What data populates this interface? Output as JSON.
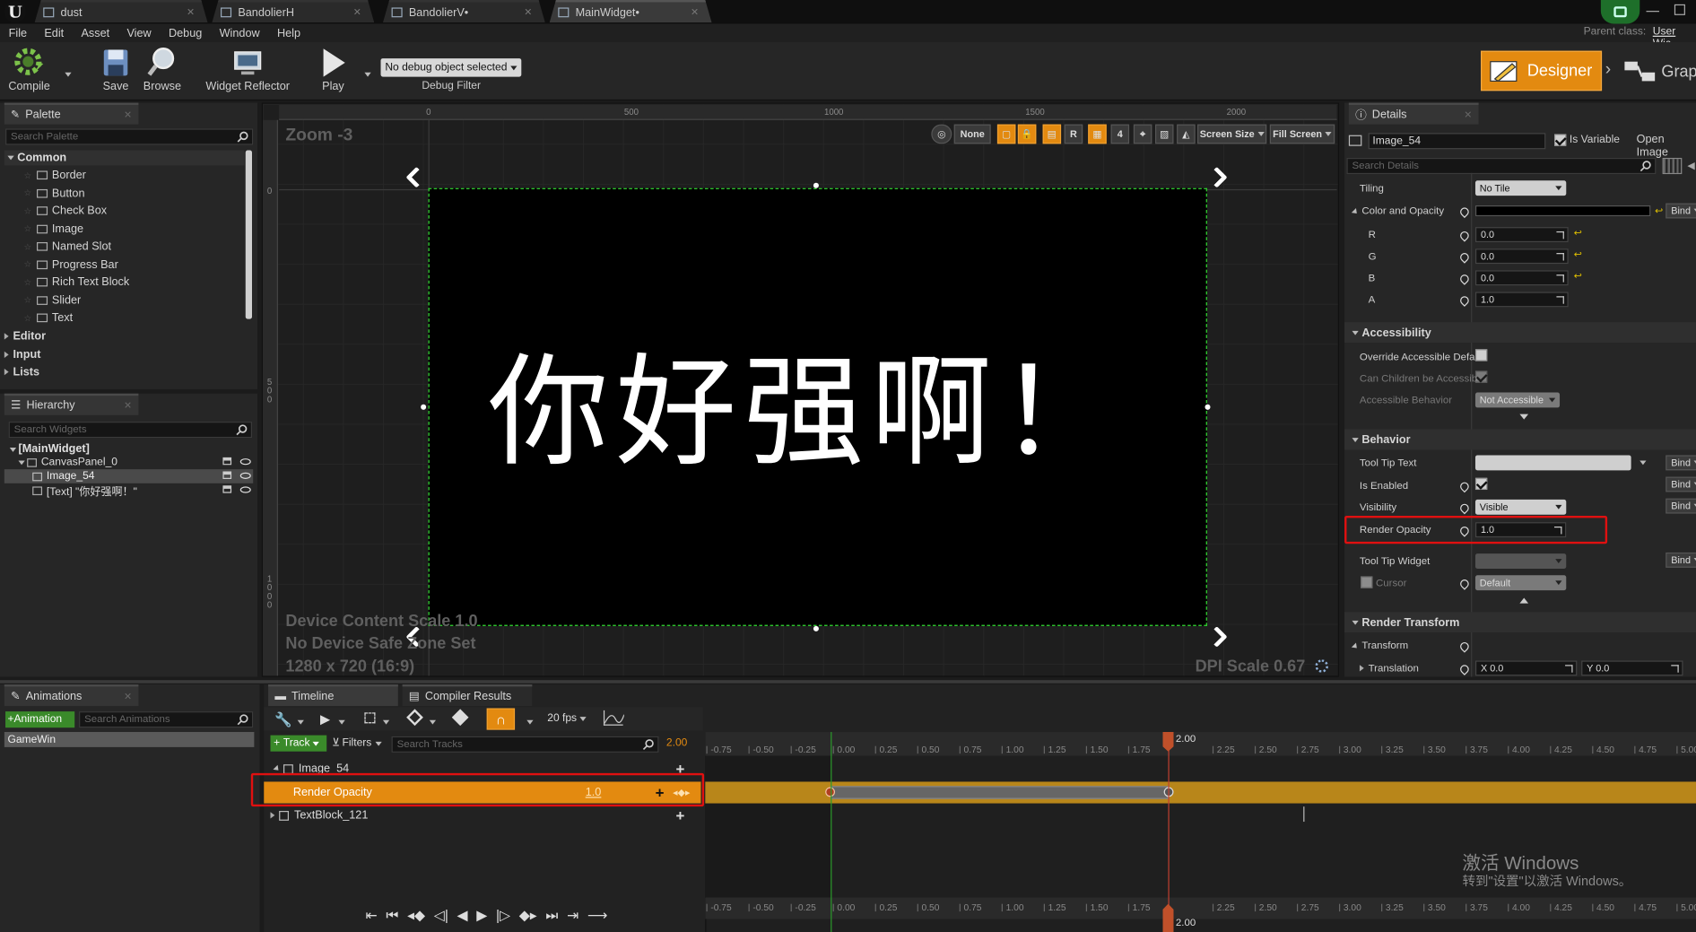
{
  "tabs": [
    {
      "label": "dust",
      "active": false
    },
    {
      "label": "BandolierH",
      "active": false
    },
    {
      "label": "BandolierV•",
      "active": false
    },
    {
      "label": "MainWidget•",
      "active": true
    }
  ],
  "menu": [
    "File",
    "Edit",
    "Asset",
    "View",
    "Debug",
    "Window",
    "Help"
  ],
  "parent_class": {
    "label": "Parent class:",
    "value": "User Wic"
  },
  "toolbar": {
    "compile": "Compile",
    "save": "Save",
    "browse": "Browse",
    "widget_reflector": "Widget Reflector",
    "play": "Play",
    "debug_object": "No debug object selected",
    "debug_filter": "Debug Filter",
    "designer": "Designer",
    "graph": "Grap"
  },
  "palette": {
    "title": "Palette",
    "search_placeholder": "Search Palette",
    "common_label": "Common",
    "items": [
      "Border",
      "Button",
      "Check Box",
      "Image",
      "Named Slot",
      "Progress Bar",
      "Rich Text Block",
      "Slider",
      "Text"
    ],
    "categories": [
      "Editor",
      "Input",
      "Lists"
    ]
  },
  "hierarchy": {
    "title": "Hierarchy",
    "search_placeholder": "Search Widgets",
    "root": "[MainWidget]",
    "canvas": "CanvasPanel_0",
    "image": "Image_54",
    "text": "[Text] \"你好强啊！\""
  },
  "viewport": {
    "zoom": "Zoom -3",
    "ruler_top": [
      "0",
      "500",
      "1000",
      "1500",
      "2000"
    ],
    "ruler_left": [
      "0",
      "500",
      "1000"
    ],
    "buttons": {
      "none": "None",
      "r": "R",
      "four": "4",
      "screen_size": "Screen Size",
      "fill_screen": "Fill Screen"
    },
    "canvas_text": "你好强啊！",
    "device_scale": "Device Content Scale 1.0",
    "safe_zone": "No Device Safe Zone Set",
    "resolution": "1280 x 720 (16:9)",
    "dpi": "DPI Scale 0.67"
  },
  "details": {
    "title": "Details",
    "name_value": "Image_54",
    "is_variable": "Is Variable",
    "open_image": "Open Image",
    "search_placeholder": "Search Details",
    "tiling_label": "Tiling",
    "tiling_value": "No Tile",
    "color_label": "Color and Opacity",
    "bind": "Bind",
    "rgba": [
      {
        "label": "R",
        "value": "0.0"
      },
      {
        "label": "G",
        "value": "0.0"
      },
      {
        "label": "B",
        "value": "0.0"
      },
      {
        "label": "A",
        "value": "1.0"
      }
    ],
    "accessibility": "Accessibility",
    "override_accessible": "Override Accessible Defa",
    "can_children": "Can Children be Accessib",
    "accessible_behavior": "Accessible Behavior",
    "not_accessible": "Not Accessible",
    "behavior": "Behavior",
    "tool_tip_text": "Tool Tip Text",
    "is_enabled": "Is Enabled",
    "visibility": "Visibility",
    "visibility_value": "Visible",
    "render_opacity": "Render Opacity",
    "render_opacity_value": "1.0",
    "tool_tip_widget": "Tool Tip Widget",
    "cursor": "Cursor",
    "cursor_value": "Default",
    "render_transform": "Render Transform",
    "transform": "Transform",
    "translation": "Translation",
    "translation_x": "X 0.0",
    "translation_y": "Y 0.0"
  },
  "animations": {
    "title": "Animations",
    "add_button": "+Animation",
    "search_placeholder": "Search Animations",
    "items": [
      "GameWin"
    ]
  },
  "timeline": {
    "tab": "Timeline",
    "compiler_tab": "Compiler Results",
    "fps": "20 fps",
    "track": "Track",
    "filters": "Filters",
    "search_placeholder": "Search Tracks",
    "time_value": "2.00",
    "image_track": "Image_54",
    "render_opacity": "Render Opacity",
    "render_opacity_value": "1.0",
    "textblock_track": "TextBlock_121",
    "ticks": [
      "-0.75",
      "-0.50",
      "-0.25",
      "0.00",
      "0.25",
      "0.50",
      "0.75",
      "1.00",
      "1.25",
      "1.50",
      "1.75",
      "2.00",
      "2.25",
      "2.50",
      "2.75",
      "3.00",
      "3.25",
      "3.50",
      "3.75",
      "4.00",
      "4.25",
      "4.50",
      "4.75",
      "5.00"
    ],
    "playhead": "2.00"
  },
  "watermark": {
    "line1": "激活 Windows",
    "line2": "转到\"设置\"以激活 Windows。"
  },
  "colors": {
    "accent_orange": "#e38a10",
    "highlight_red": "#e01010",
    "selection_green": "#33dd33"
  }
}
